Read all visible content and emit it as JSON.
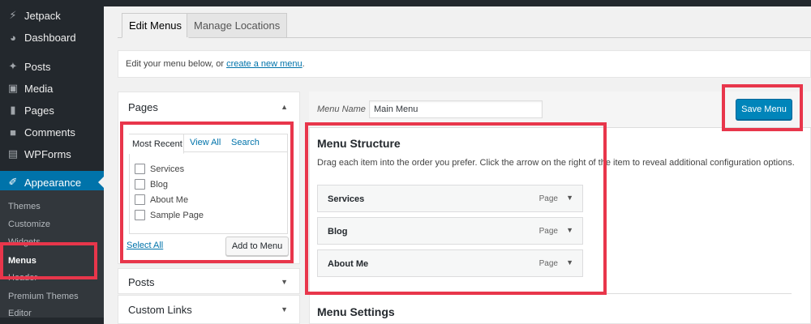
{
  "sidebar": {
    "items": [
      {
        "label": "Jetpack",
        "icon": "jetpack-icon"
      },
      {
        "label": "Dashboard",
        "icon": "dashboard-icon"
      },
      {
        "label": "Posts",
        "icon": "pin-icon"
      },
      {
        "label": "Media",
        "icon": "media-icon"
      },
      {
        "label": "Pages",
        "icon": "pages-icon"
      },
      {
        "label": "Comments",
        "icon": "comments-icon"
      },
      {
        "label": "WPForms",
        "icon": "forms-icon"
      },
      {
        "label": "Appearance",
        "icon": "brush-icon"
      }
    ],
    "submenu": [
      "Themes",
      "Customize",
      "Widgets",
      "Menus",
      "Header",
      "Premium Themes",
      "Editor"
    ]
  },
  "tabs": {
    "edit": "Edit Menus",
    "manage": "Manage Locations"
  },
  "notice": {
    "text": "Edit your menu below, or",
    "link": "create a new menu",
    "end": "."
  },
  "left": {
    "pages_title": "Pages",
    "page_tabs": [
      "Most Recent",
      "View All",
      "Search"
    ],
    "pages": [
      "Services",
      "Blog",
      "About Me",
      "Sample Page"
    ],
    "select_all": "Select All",
    "add_button": "Add to Menu",
    "posts_title": "Posts",
    "custom_links_title": "Custom Links"
  },
  "menu": {
    "name_label": "Menu Name",
    "name_value": "Main Menu",
    "save_button": "Save Menu",
    "structure_title": "Menu Structure",
    "structure_desc": "Drag each item into the order you prefer. Click the arrow on the right of the item to reveal additional configuration options.",
    "items": [
      {
        "label": "Services",
        "type": "Page"
      },
      {
        "label": "Blog",
        "type": "Page"
      },
      {
        "label": "About Me",
        "type": "Page"
      }
    ],
    "settings_title": "Menu Settings"
  },
  "colors": {
    "highlight": "#e8364b",
    "primary": "#0085ba",
    "sidebar": "#23282d",
    "active": "#0073aa"
  }
}
